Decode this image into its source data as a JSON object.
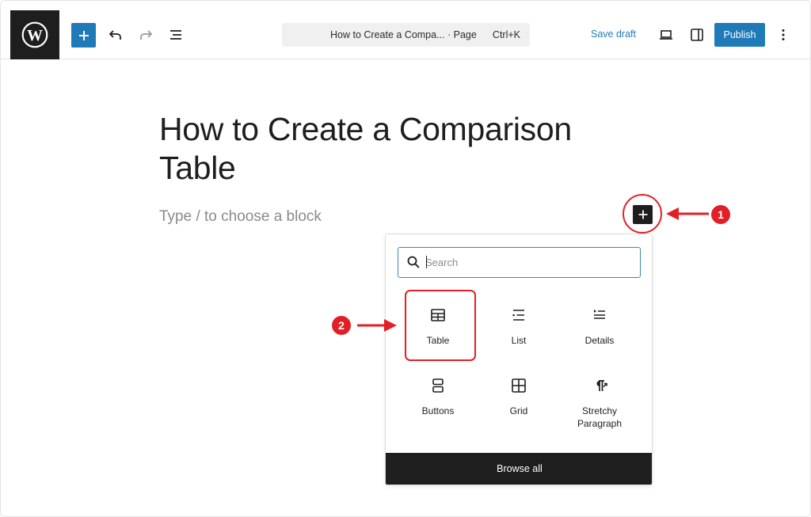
{
  "topbar": {
    "logo_icon": "wordpress-logo-icon",
    "add_icon": "plus-icon",
    "undo_icon": "undo-icon",
    "redo_icon": "redo-icon",
    "list_view_icon": "document-overview-icon",
    "command_bar": {
      "title": "How to Create a Compa... · Page",
      "shortcut": "Ctrl+K"
    },
    "save_draft_label": "Save draft",
    "preview_icon": "desktop-preview-icon",
    "settings_icon": "sidebar-settings-icon",
    "publish_label": "Publish",
    "options_icon": "more-vertical-icon"
  },
  "editor": {
    "post_title": "How to Create a Comparison Table",
    "block_placeholder": "Type / to choose a block"
  },
  "annotations": {
    "step_1": "1",
    "step_2": "2",
    "accent_color": "#e21f26"
  },
  "inserter": {
    "search_placeholder": "Search",
    "blocks": [
      {
        "label": "Table",
        "icon": "table-icon"
      },
      {
        "label": "List",
        "icon": "list-icon"
      },
      {
        "label": "Details",
        "icon": "details-icon"
      },
      {
        "label": "Buttons",
        "icon": "buttons-icon"
      },
      {
        "label": "Grid",
        "icon": "grid-icon"
      },
      {
        "label": "Stretchy Paragraph",
        "icon": "stretchy-paragraph-icon"
      }
    ],
    "browse_all_label": "Browse all"
  },
  "colors": {
    "wp_blue": "#1f7ab8",
    "dark": "#1e1e1e"
  }
}
